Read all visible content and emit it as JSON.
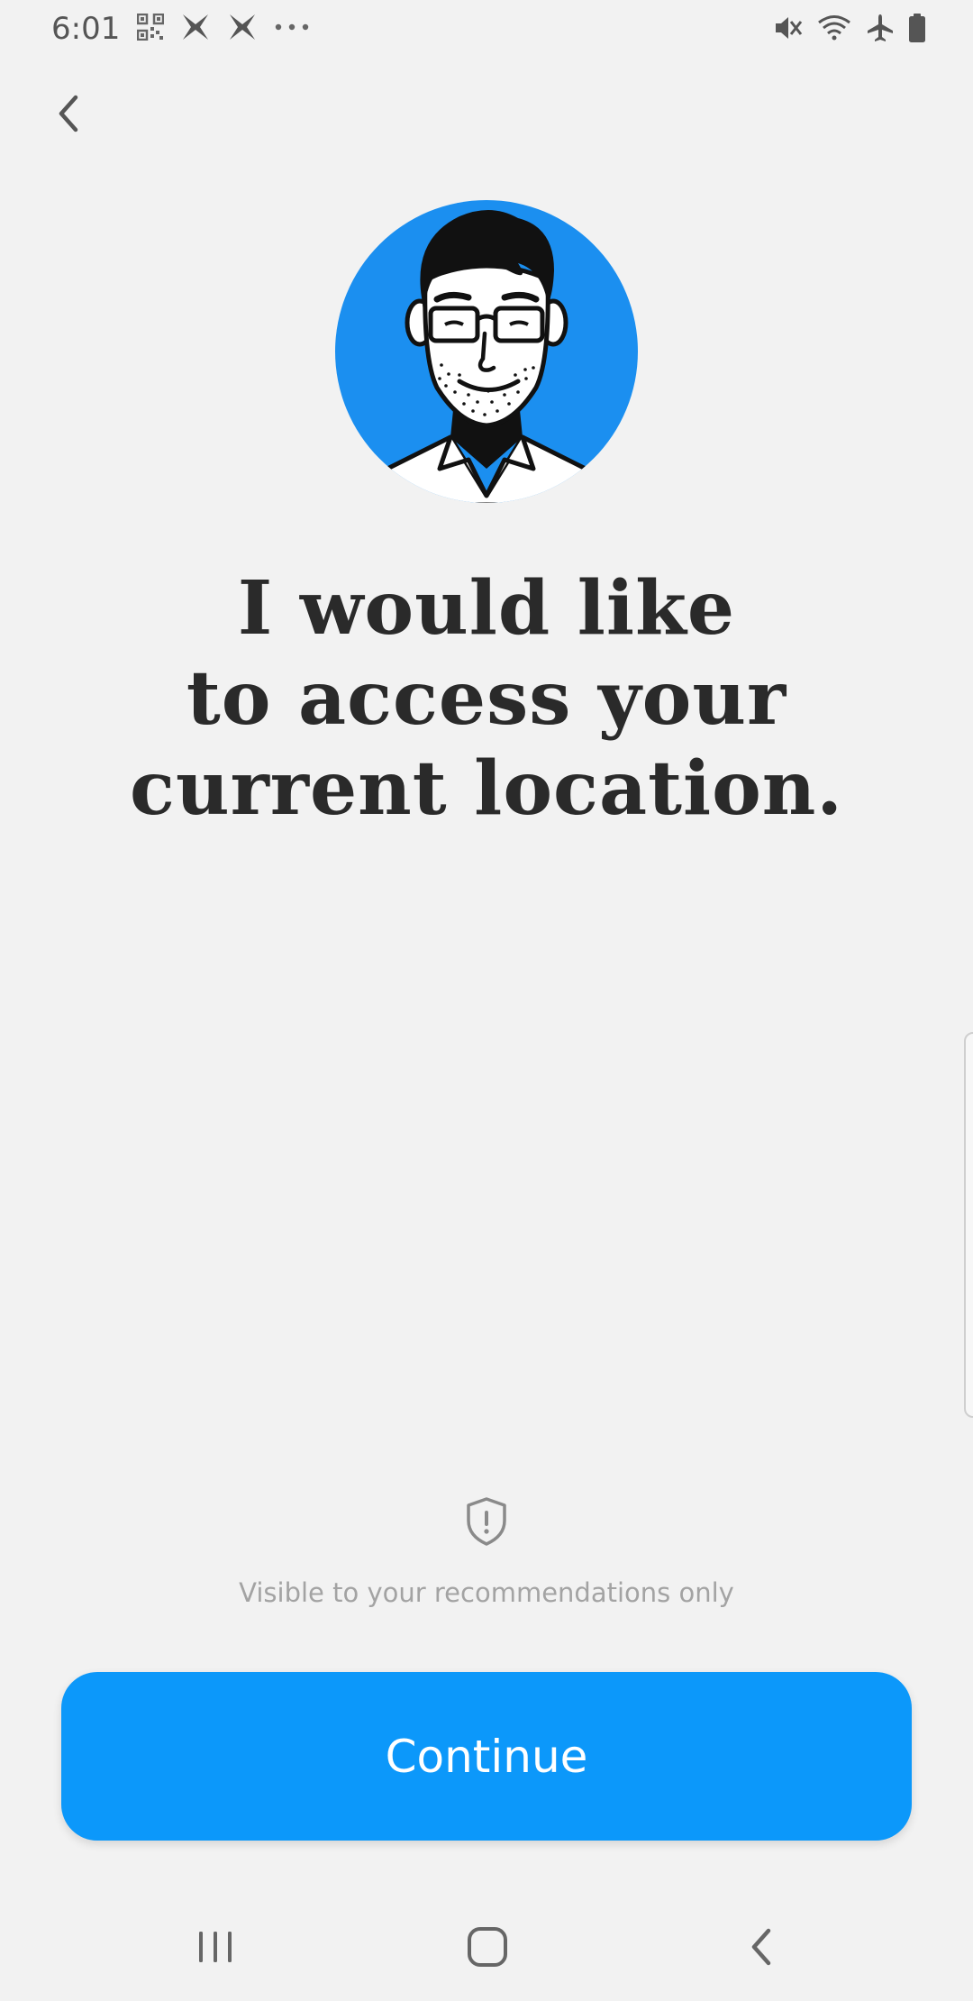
{
  "status_bar": {
    "time": "6:01",
    "left_icons": [
      "qr-code-icon",
      "app-x-icon",
      "app-x-icon",
      "more-dots-icon"
    ],
    "right_icons": [
      "mute-icon",
      "wifi-icon",
      "airplane-icon",
      "battery-icon"
    ]
  },
  "header": {
    "back_icon": "chevron-left-icon"
  },
  "avatar": {
    "background_color": "#1b8ff0"
  },
  "main": {
    "heading": "I would like\nto access your\ncurrent location."
  },
  "privacy": {
    "icon": "shield-alert-icon",
    "note": "Visible to your recommendations only"
  },
  "actions": {
    "continue_label": "Continue",
    "accent_color": "#0c98fa"
  },
  "nav_bar": {
    "icons": [
      "recent-apps-icon",
      "home-icon",
      "back-icon"
    ]
  }
}
